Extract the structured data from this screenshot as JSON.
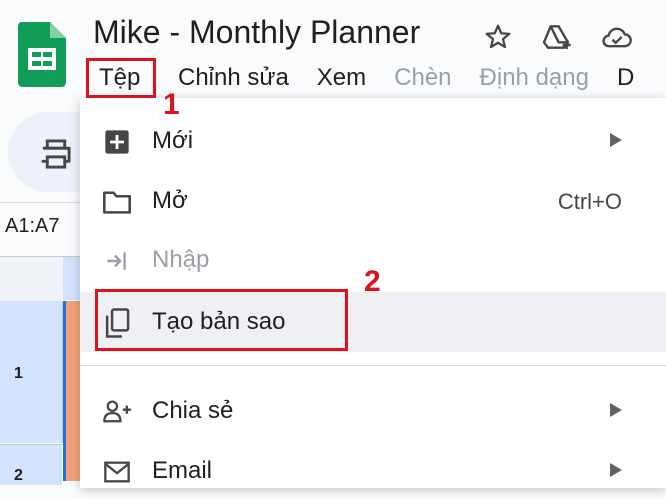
{
  "document": {
    "title": "Mike - Monthly Planner"
  },
  "menubar": {
    "items": [
      {
        "label": "Tệp",
        "state": "active"
      },
      {
        "label": "Chỉnh sửa",
        "state": "enabled"
      },
      {
        "label": "Xem",
        "state": "enabled"
      },
      {
        "label": "Chèn",
        "state": "disabled"
      },
      {
        "label": "Định dạng",
        "state": "disabled"
      },
      {
        "label": "D",
        "state": "enabled"
      }
    ]
  },
  "namebox": {
    "value": "A1:A7"
  },
  "rows": [
    "1",
    "2"
  ],
  "file_menu": {
    "items": [
      {
        "label": "Mới",
        "icon": "new-plus-icon",
        "submenu": true
      },
      {
        "label": "Mở",
        "icon": "folder-icon",
        "shortcut": "Ctrl+O"
      },
      {
        "label": "Nhập",
        "icon": "import-icon",
        "disabled": true
      },
      {
        "label": "Tạo bản sao",
        "icon": "copy-icon",
        "highlighted": true
      },
      {
        "label": "Chia sẻ",
        "icon": "add-person-icon",
        "submenu": true
      },
      {
        "label": "Email",
        "icon": "mail-icon",
        "submenu": true
      }
    ]
  },
  "annotations": {
    "step1": "1",
    "step2": "2"
  },
  "colors": {
    "annotation": "#e0111b",
    "sheets_green": "#0f9d58",
    "selection_blue": "#d3e3fd",
    "cell_fill": "#f4a07a"
  }
}
